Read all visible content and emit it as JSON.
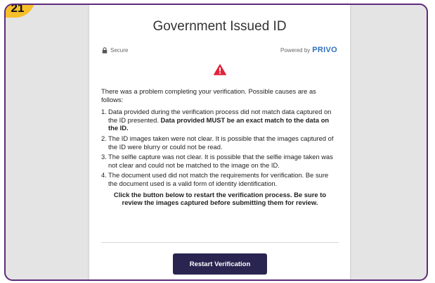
{
  "step_badge": "21",
  "title": "Government Issued ID",
  "secure_label": "Secure",
  "powered_by": "Powered by",
  "brand": "PRIVO",
  "icons": {
    "lock": "lock-icon",
    "warning": "warning-icon"
  },
  "colors": {
    "frame_border": "#5e2b7a",
    "badge": "#f5bf2a",
    "warning": "#e0243b",
    "brand": "#2f6fbf",
    "button": "#2a2450"
  },
  "intro": "There was a problem completing your verification. Possible causes are as follows:",
  "causes": [
    {
      "num": "1.",
      "text": "Data provided during the verification process did not match data captured on the ID presented. ",
      "bold": "Data provided MUST be an exact match to the data on the ID."
    },
    {
      "num": "2.",
      "text": "The ID images taken were not clear. It is possible that the images captured of the ID were blurry or could not be read.",
      "bold": ""
    },
    {
      "num": "3.",
      "text": "The selfie capture was not clear. It is possible that the selfie image taken was not clear and could not be matched to the image on the ID.",
      "bold": ""
    },
    {
      "num": "4.",
      "text": "The document used did not match the requirements for verification. Be sure the document used is a valid form of identity identification.",
      "bold": ""
    }
  ],
  "closing": "Click the button below to restart the verification process. Be sure to review the images captured before submitting them for review.",
  "restart_button": "Restart Verification"
}
